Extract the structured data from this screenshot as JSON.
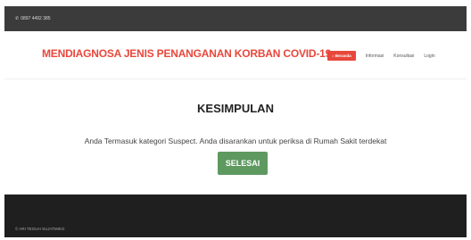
{
  "topbar": {
    "phone_icon": "phone-icon",
    "phone": "0897 4492 385"
  },
  "navbar": {
    "brand": "MENDIAGNOSA JENIS PENANGANAN KORBAN COVID-19",
    "nav": {
      "home_icon": "home-icon",
      "home": "Beranda",
      "info": "Informasi",
      "consult": "Konsultasi",
      "login": "Login"
    }
  },
  "main": {
    "title": "KESIMPULAN",
    "message": "Anda Termasuk kategori Suspect. Anda disarankan untuk periksa di Rumah Sakit terdekat",
    "done_button": "SELESAI"
  },
  "footer": {
    "copyright": "© ARI TEGUH SUJATMIKO"
  },
  "colors": {
    "accent": "#e8473b",
    "button": "#5e9960",
    "topbar": "#3b3b3b",
    "footer": "#1f1f1f"
  }
}
